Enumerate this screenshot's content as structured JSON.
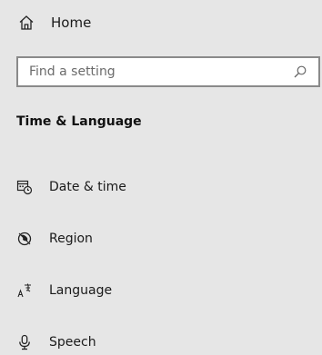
{
  "home": {
    "label": "Home",
    "icon": "home-icon"
  },
  "search": {
    "placeholder": "Find a setting",
    "icon": "search-icon"
  },
  "section": {
    "title": "Time & Language"
  },
  "nav": {
    "items": [
      {
        "label": "Date & time",
        "icon": "calendar-clock-icon"
      },
      {
        "label": "Region",
        "icon": "globe-icon"
      },
      {
        "label": "Language",
        "icon": "language-icon"
      },
      {
        "label": "Speech",
        "icon": "microphone-icon"
      }
    ]
  },
  "colors": {
    "background": "#e6e6e6",
    "text": "#1a1a1a",
    "search_border": "#8a8a8a",
    "placeholder": "#6b6b6b"
  }
}
